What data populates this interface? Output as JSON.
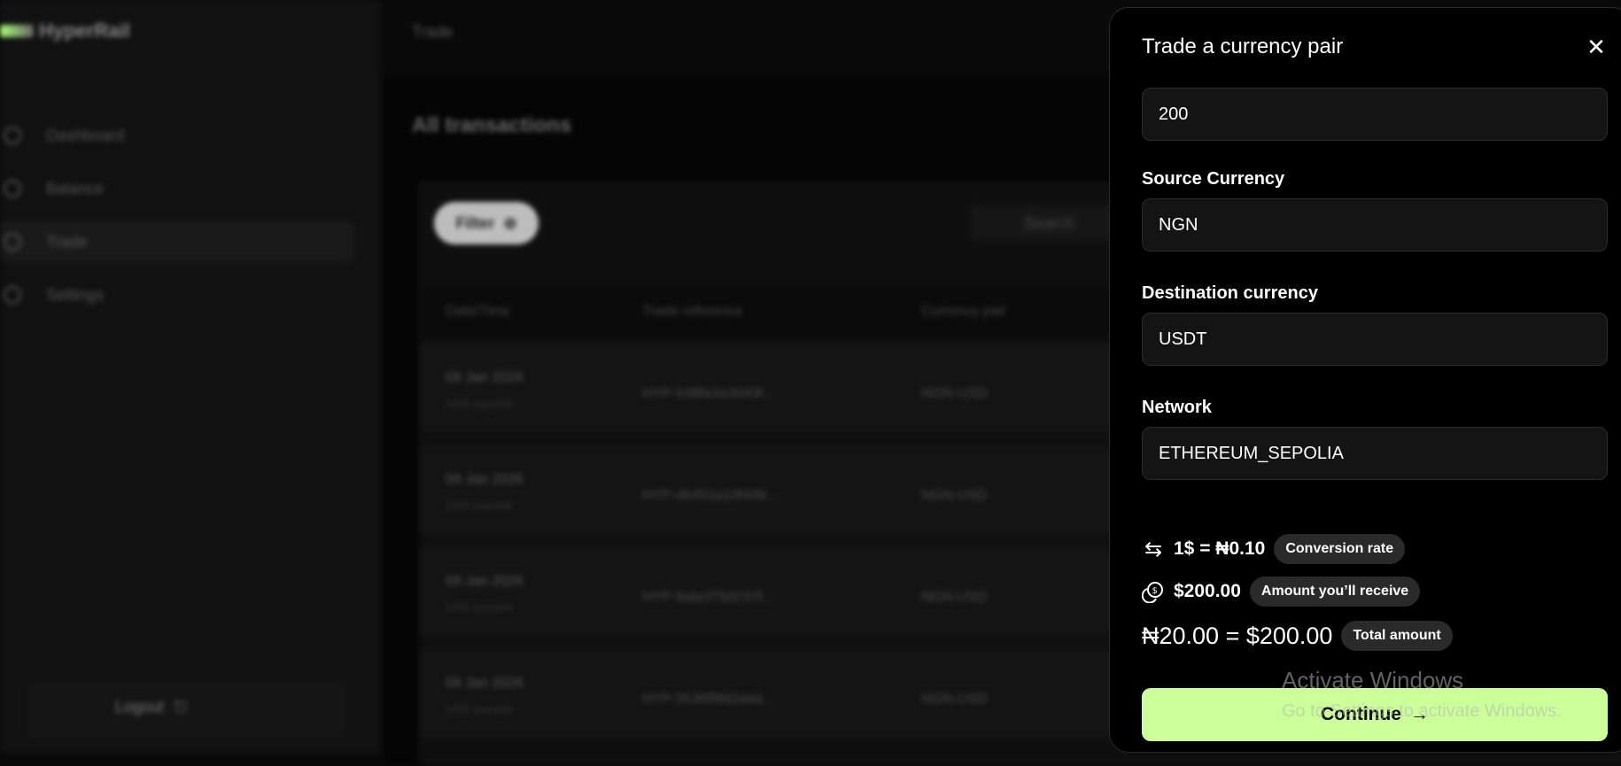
{
  "background": {
    "brand": "HyperRail",
    "top_title": "Trade",
    "nav": [
      "Dashboard",
      "Balance",
      "Trade",
      "Settings"
    ],
    "logout": "Logout",
    "section_title": "All transactions",
    "filter_label": "Filter",
    "search_placeholder": "Search",
    "columns": [
      "Date/Time",
      "Trade reference",
      "Currency pair"
    ],
    "rows": [
      {
        "date": "09 Jan 2026",
        "sub": "USD payable",
        "ref": "HYP-b38fa3a3043f...",
        "pair": "NGN-USD"
      },
      {
        "date": "09 Jan 2026",
        "sub": "USD payable",
        "ref": "HYP-d6452a19f436...",
        "pair": "NGN-USD"
      },
      {
        "date": "09 Jan 2026",
        "sub": "USD payable",
        "ref": "HYP-8abcf79d237f...",
        "pair": "NGN-USD"
      },
      {
        "date": "09 Jan 2026",
        "sub": "USD payable",
        "ref": "HYP-5536f9fd2a4a...",
        "pair": "NGN-USD"
      }
    ]
  },
  "modal": {
    "title": "Trade a currency pair",
    "close_icon": "close-icon",
    "amount_value": "200",
    "source_label": "Source Currency",
    "source_value": "NGN",
    "dest_label": "Destination currency",
    "dest_value": "USDT",
    "network_label": "Network",
    "network_value": "ETHEREUM_SEPOLIA",
    "rate_value": "1$ = ₦0.10",
    "rate_badge": "Conversion rate",
    "receive_value": "$200.00",
    "receive_badge": "Amount you’ll receive",
    "total_value": "₦20.00 = $200.00",
    "total_badge": "Total amount",
    "continue_label": "Continue"
  },
  "watermark": {
    "line1": "Activate Windows",
    "line2": "Go to Settings to activate Windows."
  },
  "colors": {
    "accent": "#ccff99",
    "modal_bg": "#000000",
    "field_bg": "#141414",
    "badge_bg": "#2a2a2a"
  }
}
